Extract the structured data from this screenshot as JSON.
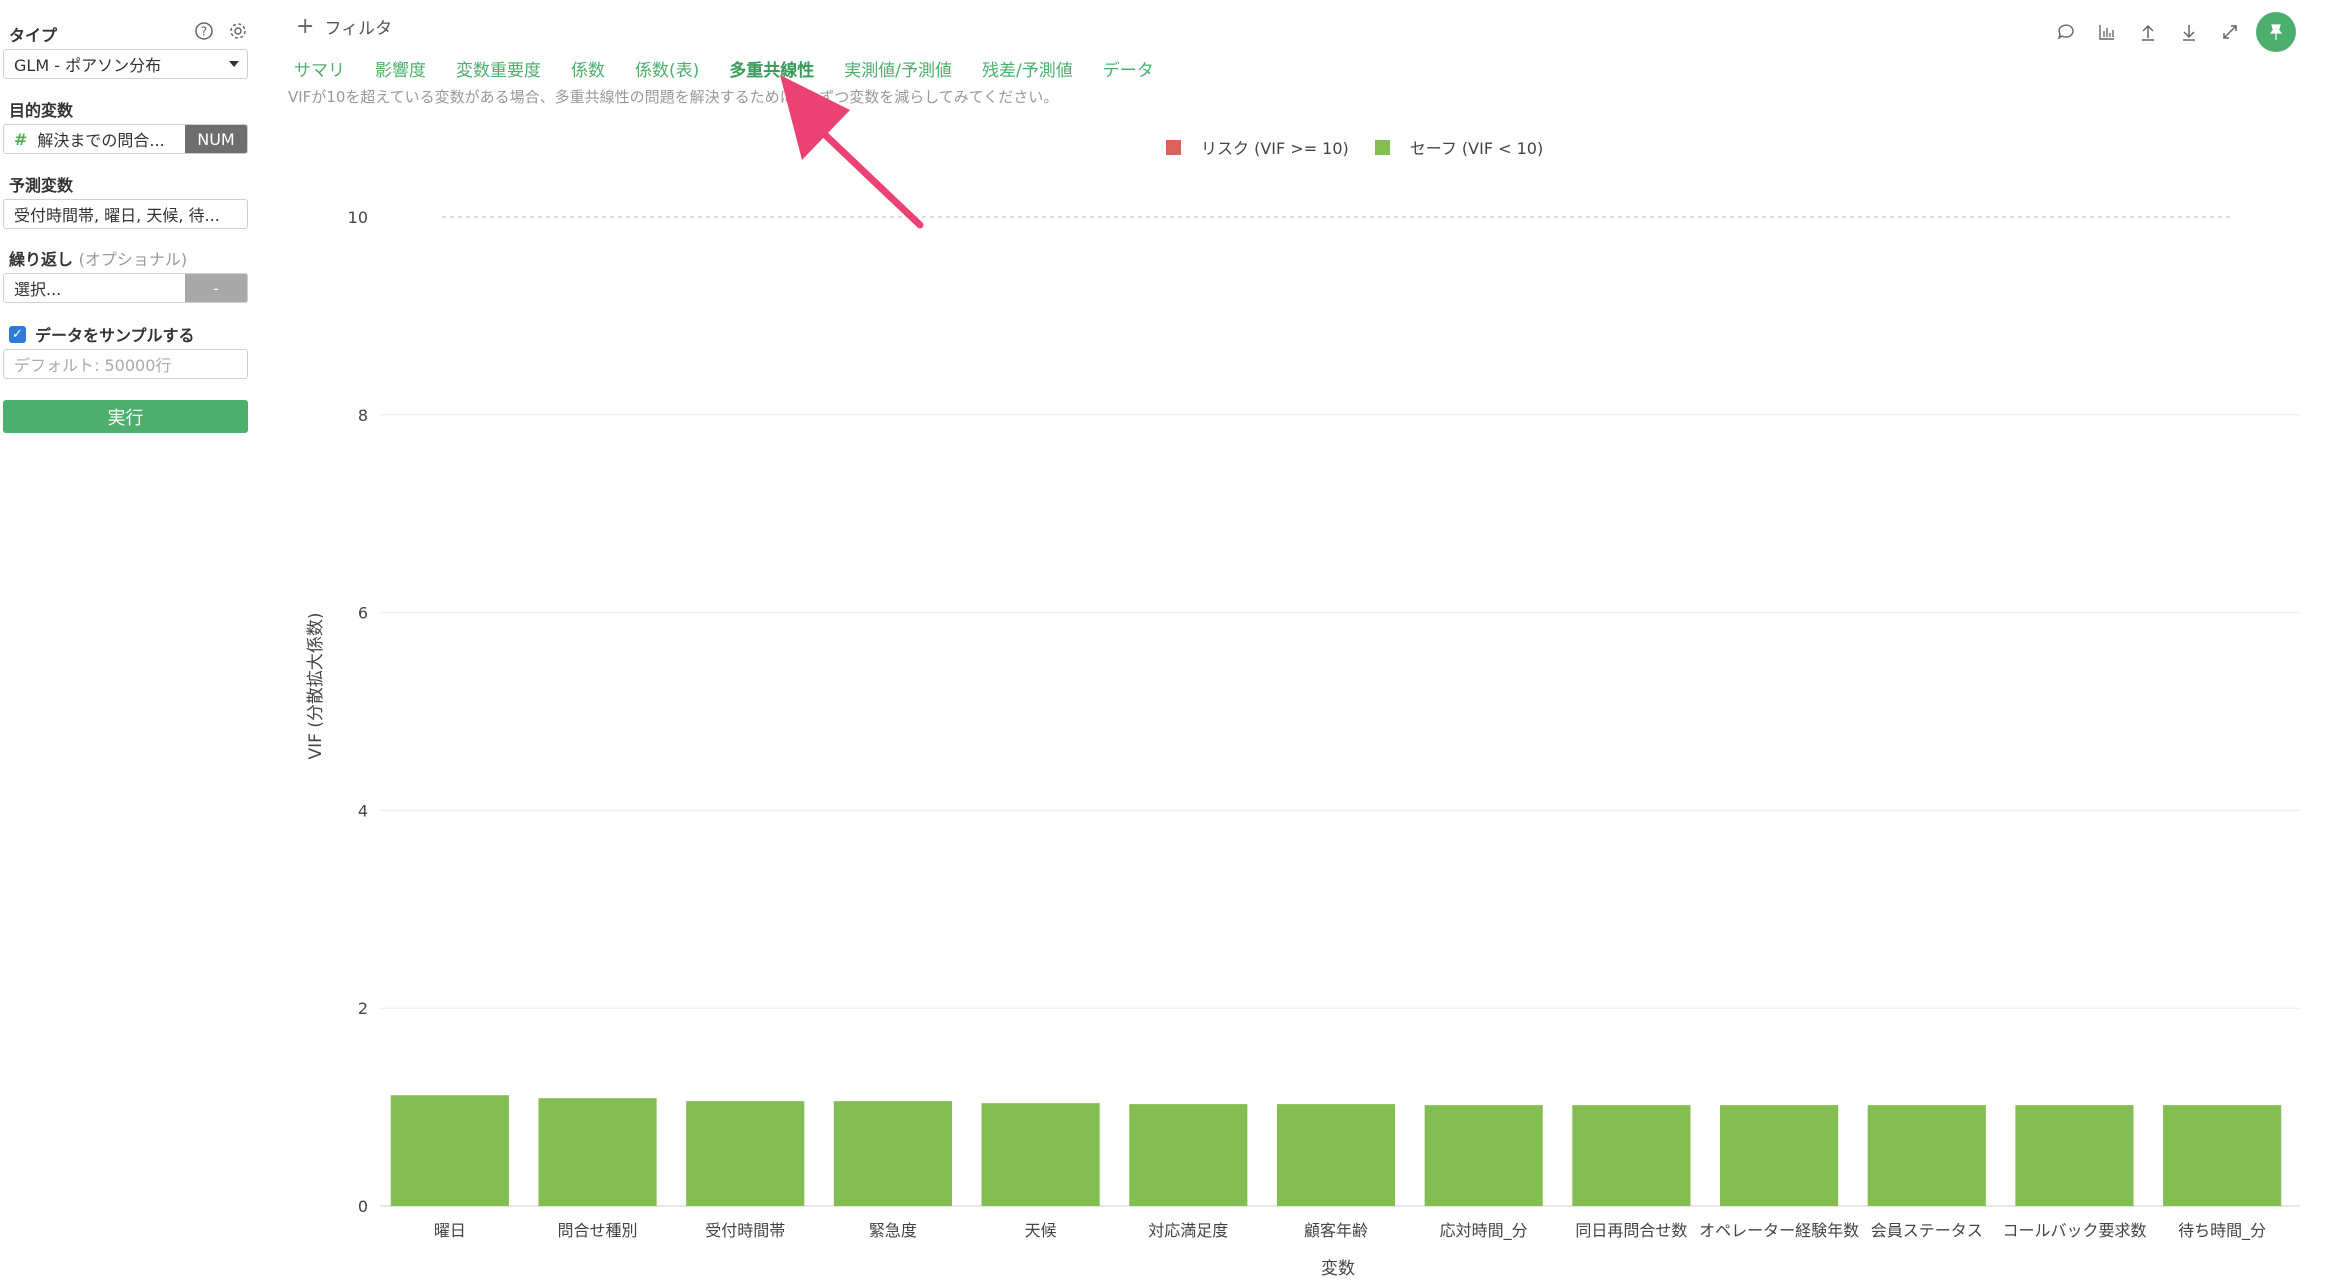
{
  "sidebar": {
    "type_label": "タイプ",
    "type_value": "GLM - ポアソン分布",
    "target_label": "目的変数",
    "target_value": "解決までの問合...",
    "target_badge": "NUM",
    "predictor_label": "予測変数",
    "predictor_value": "受付時間帯, 曜日, 天候, 待...",
    "repeat_label": "繰り返し",
    "repeat_optional": "(オプショナル)",
    "repeat_placeholder": "選択...",
    "repeat_side": "-",
    "sample_label": "データをサンプルする",
    "sample_checked": true,
    "sample_placeholder": "デフォルト: 50000行",
    "run_label": "実行"
  },
  "topbar": {
    "filter_label": "フィルタ"
  },
  "tabs": [
    {
      "label": "サマリ",
      "active": false
    },
    {
      "label": "影響度",
      "active": false
    },
    {
      "label": "変数重要度",
      "active": false
    },
    {
      "label": "係数",
      "active": false
    },
    {
      "label": "係数(表)",
      "active": false
    },
    {
      "label": "多重共線性",
      "active": true
    },
    {
      "label": "実測値/予測値",
      "active": false
    },
    {
      "label": "残差/予測値",
      "active": false
    },
    {
      "label": "データ",
      "active": false
    }
  ],
  "hint_text": "VIFが10を超えている変数がある場合、多重共線性の問題を解決するために1つずつ変数を減らしてみてください。",
  "colors": {
    "accent": "#4caf6d",
    "risk": "#d9625a",
    "safe": "#84bd52",
    "arrow": "#ec4273"
  },
  "chart_data": {
    "type": "bar",
    "title": "",
    "xlabel": "変数",
    "ylabel": "VIF (分散拡大係数)",
    "ylim": [
      0,
      10
    ],
    "yticks": [
      0,
      2,
      4,
      6,
      8,
      10
    ],
    "threshold": 10,
    "legend_position": "top-center",
    "legend": [
      {
        "name": "リスク (VIF >= 10)",
        "color": "#d9625a"
      },
      {
        "name": "セーフ (VIF < 10)",
        "color": "#84bd52"
      }
    ],
    "categories": [
      "曜日",
      "問合せ種別",
      "受付時間帯",
      "緊急度",
      "天候",
      "対応満足度",
      "顧客年齢",
      "応対時間_分",
      "同日再問合せ数",
      "オペレーター経験年数",
      "会員ステータス",
      "コールバック要求数",
      "待ち時間_分"
    ],
    "values": [
      1.12,
      1.09,
      1.06,
      1.06,
      1.04,
      1.03,
      1.03,
      1.02,
      1.02,
      1.02,
      1.02,
      1.02,
      1.02
    ]
  }
}
